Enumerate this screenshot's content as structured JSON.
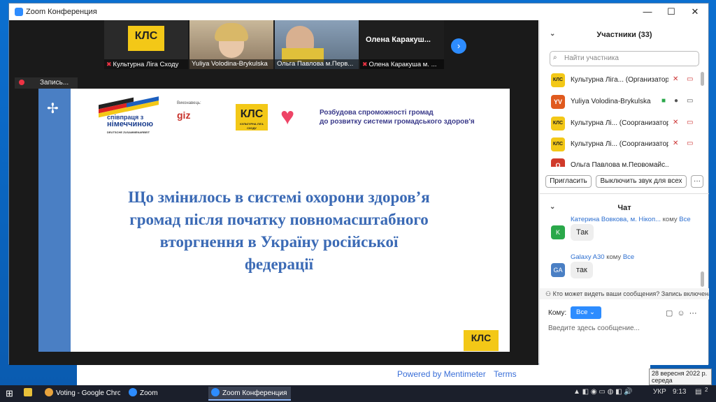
{
  "window": {
    "title": "Zoom Конференция",
    "min": "—",
    "max": "☐",
    "close": "✕"
  },
  "video_strip": {
    "tiles": [
      {
        "name": "Культурна Ліга Сходу",
        "logo_text": "КЛС"
      },
      {
        "name": "Yuliya Volodina-Brykulska"
      },
      {
        "name": "Ольга Павлова м.Перв..."
      },
      {
        "name": "Олена Каракуша м. ...",
        "center_text": "Олена  Каракуш..."
      }
    ]
  },
  "recording": {
    "label": "Запись..."
  },
  "slide": {
    "flag_caption_line1": "співпраця з",
    "flag_caption_line2": "німеччиною",
    "flag_caption_line3": "DEUTSCHE ZUSAMMENARBEIT",
    "giz_small": "Виконавець:",
    "giz": "giz",
    "kls_logo": "КЛС",
    "kls_sub": "КУЛЬТУРНА ЛІГА СХОДУ",
    "header_line1": "Розбудова спроможності громад",
    "header_line2": "до розвитку системи громадського здоров'я",
    "title_line1": "Що змінилось в системі охорони здоров’я",
    "title_line2": "громад після початку повномасштабного",
    "title_line3": "вторгнення в Україну російської",
    "title_line4": "федерації",
    "footer_logo": "КЛС"
  },
  "participants": {
    "header": "Участники (33)",
    "search_placeholder": "Найти участника",
    "rows": [
      {
        "initials": "КЛС",
        "name": "Культурна Ліга... (Организатор)",
        "color": "#f3c817"
      },
      {
        "initials": "YV",
        "name": "Yuliya Volodina-Brykulska",
        "color": "#e05a1e"
      },
      {
        "initials": "КЛС",
        "name": "Культурна Лі... (Соорганизатор)",
        "color": "#f3c817"
      },
      {
        "initials": "КЛС",
        "name": "Культурна Лі... (Соорганизатор)",
        "color": "#f3c817"
      },
      {
        "initials": "О",
        "name": "Ольга Павлова м.Первомайс...",
        "color": "#d03a2a"
      }
    ],
    "invite_button": "Пригласить",
    "mute_all_button": "Выключить звук для всех",
    "more_button": "···"
  },
  "chat": {
    "header": "Чат",
    "messages": [
      {
        "sender": "Катерина Вовкова, м. Нікоп...",
        "to_word": "кому",
        "to": "Все",
        "initials": "K",
        "color": "#2aa84a",
        "text": "Так"
      },
      {
        "sender": "Galaxy A30",
        "to_word": "кому",
        "to": "Все",
        "initials": "GA",
        "color": "#4a7fc4",
        "text": "так"
      }
    ],
    "notice": "Кто может видеть ваши сообщения? Запись включена",
    "to_label": "Кому:",
    "to_value": "Все",
    "compose_placeholder": "Введите здесь сообщение..."
  },
  "background_page": {
    "powered_by": "Powered by Mentimeter",
    "terms": "Terms"
  },
  "datetime_tooltip": {
    "line1": "28 вересня 2022 р.",
    "line2": "середа"
  },
  "taskbar": {
    "items": [
      {
        "label": "Voting - Google Chro...",
        "color": "#e8a33d"
      },
      {
        "label": "Zoom",
        "color": "#2d8cff"
      },
      {
        "label": "Zoom Конференция",
        "color": "#2d8cff"
      }
    ],
    "language": "УКР",
    "time": "9:13",
    "notifications_count": "2"
  }
}
